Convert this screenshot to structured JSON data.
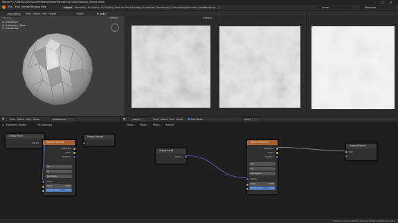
{
  "title_bar": {
    "text": "Blender* [C:\\USERS\\Gary\\2022\\06\\Voronoi\\Noise\\Textures\\2022\\06\\22\\Voronoi_Texture.blend]"
  },
  "menu": {
    "items": [
      "File",
      "Edit",
      "Render",
      "Window",
      "Help"
    ]
  },
  "workspace_tabs": {
    "items": [
      "Layout",
      "Modeling",
      "Sculpting",
      "UV Editing",
      "Texture Paint",
      "Shading",
      "Animation",
      "Rendering",
      "Compositing",
      "Geometry Nodes",
      "Scripting"
    ],
    "active": "Layout"
  },
  "top_right": {
    "scene": "Scene",
    "view_layer": "ViewLayer"
  },
  "viewport_header": {
    "mode": "Object Mode",
    "menus": [
      "View",
      "Select",
      "Add",
      "Object"
    ],
    "global": "Global",
    "options": "Options"
  },
  "outliner": {
    "lines": [
      "(1) Collection",
      "(1) Collection | Mine",
      "(1) Cardiovasc"
    ]
  },
  "uv_header": {
    "options": "Options"
  },
  "node_editor_left": {
    "menus": [
      "View",
      "Select",
      "Add",
      "Node"
    ],
    "node_tree": "SVGTextures",
    "breadcrumb": "Geometry Nodes",
    "panel_tab": "SVGTextures",
    "group_input": {
      "title": "Group Input",
      "output": "Vector"
    },
    "voronoi": {
      "title": "Voronoi Texture",
      "outputs": [
        "Distance",
        "Color",
        "Position"
      ],
      "dim": "3D",
      "feature": "F2",
      "metric": "Manhattan",
      "inputs_label": "Vector",
      "scale_label": "Scale",
      "scale_value": "5.000",
      "randomness_label": "Randomness",
      "randomness_value": "1.000"
    },
    "group_output": {
      "title": "Group Output"
    }
  },
  "node_editor_right": {
    "menus": [
      "Object",
      "View",
      "Select",
      "Add",
      "Node"
    ],
    "use_nodes": "Use Nodes",
    "slot": "Slot 1",
    "breadcrumb": [
      "Plane",
      "Plane",
      "Plane",
      "Texture"
    ],
    "group_input": {
      "title": "Group Input",
      "output": "Vector"
    },
    "voronoi": {
      "title": "Voronoi Texture",
      "outputs": [
        "Distance",
        "Color",
        "Position"
      ],
      "dim": "3D",
      "feature": "F2",
      "metric": "Manhattan",
      "inputs_label": "Vector",
      "scale_label": "Scale",
      "scale_value": "5.000",
      "randomness_label": "Randomness",
      "randomness_value": "1.000"
    },
    "group_output": {
      "title": "Group Output",
      "input": "Fac"
    }
  },
  "status_bar": {
    "text": "Collection | Cube | Verts:8 | Faces:6 | Tris:12 | Objects:1/1 | 3.2.0"
  },
  "colors": {
    "bg": "#1d1d1d",
    "panel": "#2b2b2b",
    "node_body": "#303030",
    "texture_node_head": "#a9602c",
    "group_node_head": "#3b3b3b",
    "vector_socket": "#6363c7",
    "float_socket": "#a1a1a1",
    "color_socket": "#c7c729",
    "field_blue": "#4772b3"
  }
}
